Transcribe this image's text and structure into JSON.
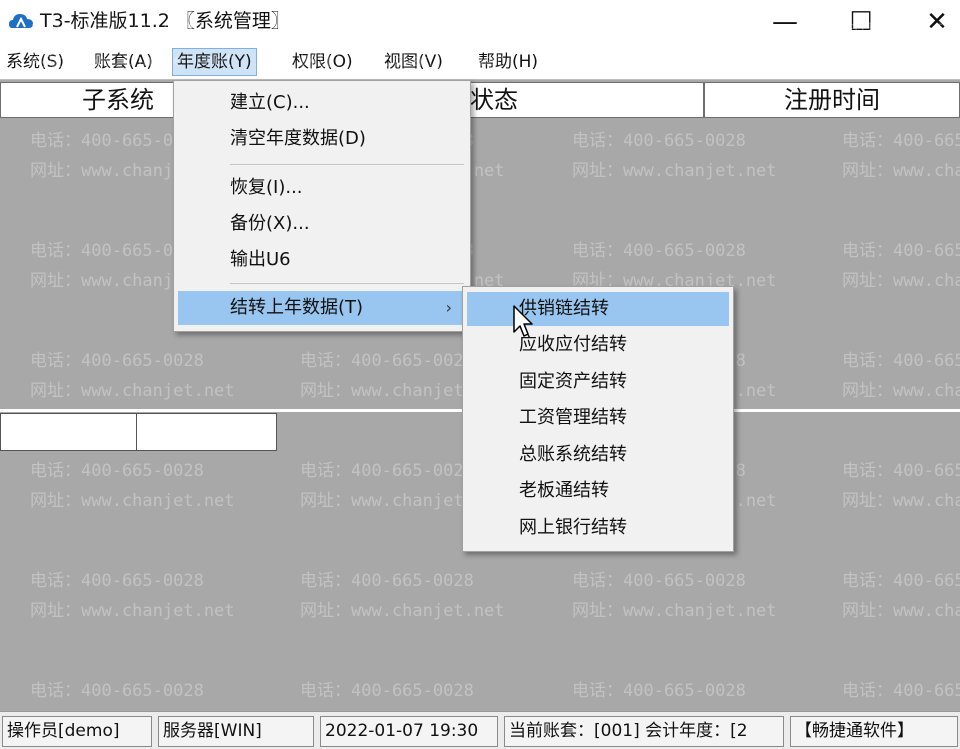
{
  "window": {
    "title": "T3-标准版11.2 〖系统管理〗",
    "minimize_glyph": "—",
    "maximize_glyph": "☐",
    "close_glyph": "✕"
  },
  "menubar": {
    "items": [
      "系统(S)",
      "账套(A)",
      "年度账(Y)",
      "权限(O)",
      "视图(V)",
      "帮助(H)"
    ],
    "active_index": 2
  },
  "table_header": {
    "col_subsystem": "子系统",
    "col_status": "运行状态",
    "col_register_time": "注册时间"
  },
  "dropdown": {
    "items": [
      "建立(C)...",
      "清空年度数据(D)",
      "恢复(I)...",
      "备份(X)...",
      "输出U6",
      "结转上年数据(T)"
    ],
    "submenu_arrow": "›",
    "highlighted_index": 5
  },
  "submenu": {
    "items": [
      "供销链结转",
      "应收应付结转",
      "固定资产结转",
      "工资管理结转",
      "总账系统结转",
      "老板通结转",
      "网上银行结转"
    ],
    "highlighted_index": 0
  },
  "watermark": {
    "phone": "电话：400-665-0028",
    "site": "网址：www.chanjet.net"
  },
  "statusbar": {
    "operator": "操作员[demo]",
    "server": "服务器[WIN]",
    "datetime": "2022-01-07 19:30",
    "current_account": "当前账套：[001] 会计年度：[2",
    "product": "【畅捷通软件】"
  },
  "colors": {
    "background": "#a8a8a8",
    "menu_highlight": "#99c6f0",
    "active_menu": "#cfe3f7"
  }
}
